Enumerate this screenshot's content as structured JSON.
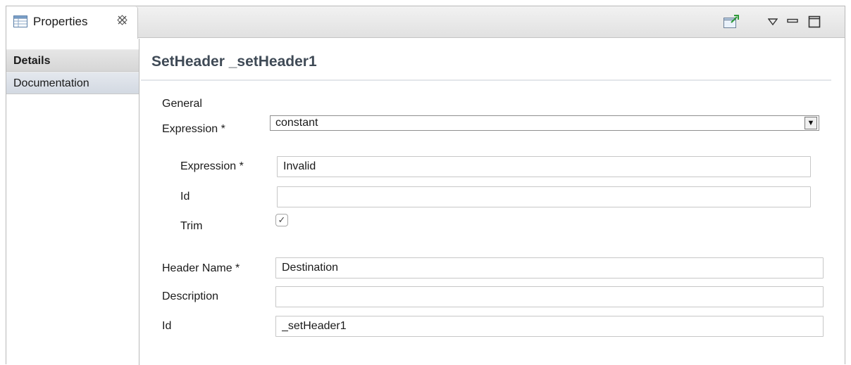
{
  "view": {
    "tab_label": "Properties",
    "tab_icon": "properties-table-icon",
    "close_icon": "close-x-icon",
    "toolbar": [
      "pin-to-view-icon",
      "view-menu-icon",
      "minimize-icon",
      "maximize-icon"
    ]
  },
  "categories": [
    {
      "label": "Details",
      "active": true
    },
    {
      "label": "Documentation",
      "active": false
    }
  ],
  "page": {
    "title": "SetHeader _setHeader1",
    "section": "General",
    "expression_label": "Expression *",
    "expression_value": "constant",
    "sub": {
      "expression_label": "Expression *",
      "expression_value": "Invalid",
      "id_label": "Id",
      "id_value": "",
      "trim_label": "Trim",
      "trim_checked": true
    },
    "header_name_label": "Header Name *",
    "header_name_value": "Destination",
    "description_label": "Description",
    "description_value": "",
    "id_label": "Id",
    "id_value": "_setHeader1"
  }
}
